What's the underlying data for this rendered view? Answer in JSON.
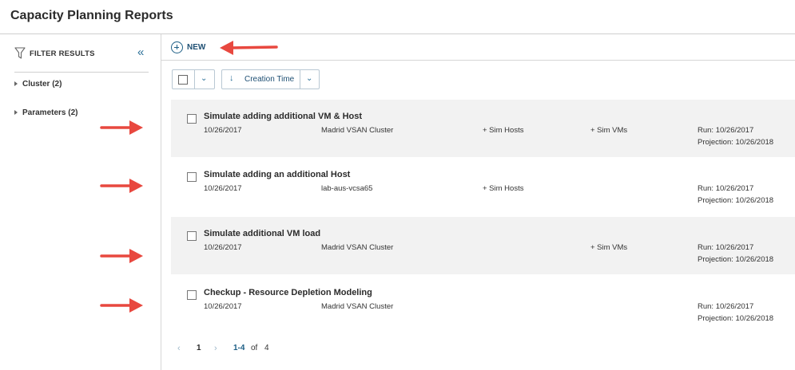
{
  "header": {
    "title": "Capacity Planning Reports"
  },
  "sidebar": {
    "filter_label": "FILTER RESULTS",
    "collapse_glyph": "«",
    "groups": [
      {
        "label": "Cluster (2)"
      },
      {
        "label": "Parameters (2)"
      }
    ]
  },
  "toolbar": {
    "new_label": "NEW",
    "sort_label": "Creation Time",
    "sort_arrow": "↓",
    "chevron": "⌄"
  },
  "reports": [
    {
      "name": "Simulate adding additional VM & Host",
      "date": "10/26/2017",
      "cluster": "Madrid VSAN Cluster",
      "sim_hosts": "+ Sim Hosts",
      "sim_vms": "+ Sim VMs",
      "run": "Run: 10/26/2017",
      "projection": "Projection: 10/26/2018"
    },
    {
      "name": "Simulate adding an additional Host",
      "date": "10/26/2017",
      "cluster": "lab-aus-vcsa65",
      "sim_hosts": "+ Sim Hosts",
      "sim_vms": "",
      "run": "Run: 10/26/2017",
      "projection": "Projection: 10/26/2018"
    },
    {
      "name": "Simulate additional VM load",
      "date": "10/26/2017",
      "cluster": "Madrid VSAN Cluster",
      "sim_hosts": "",
      "sim_vms": "+ Sim VMs",
      "run": "Run: 10/26/2017",
      "projection": "Projection: 10/26/2018"
    },
    {
      "name": "Checkup - Resource Depletion Modeling",
      "date": "10/26/2017",
      "cluster": "Madrid VSAN Cluster",
      "sim_hosts": "",
      "sim_vms": "",
      "run": "Run: 10/26/2017",
      "projection": "Projection: 10/26/2018"
    }
  ],
  "pagination": {
    "prev": "‹",
    "current": "1",
    "next": "›",
    "range": "1-4",
    "of": "of",
    "total": "4"
  },
  "colors": {
    "accent": "#1e5f86",
    "callout_arrow": "#e8483f",
    "row_shade": "#f2f2f2"
  }
}
